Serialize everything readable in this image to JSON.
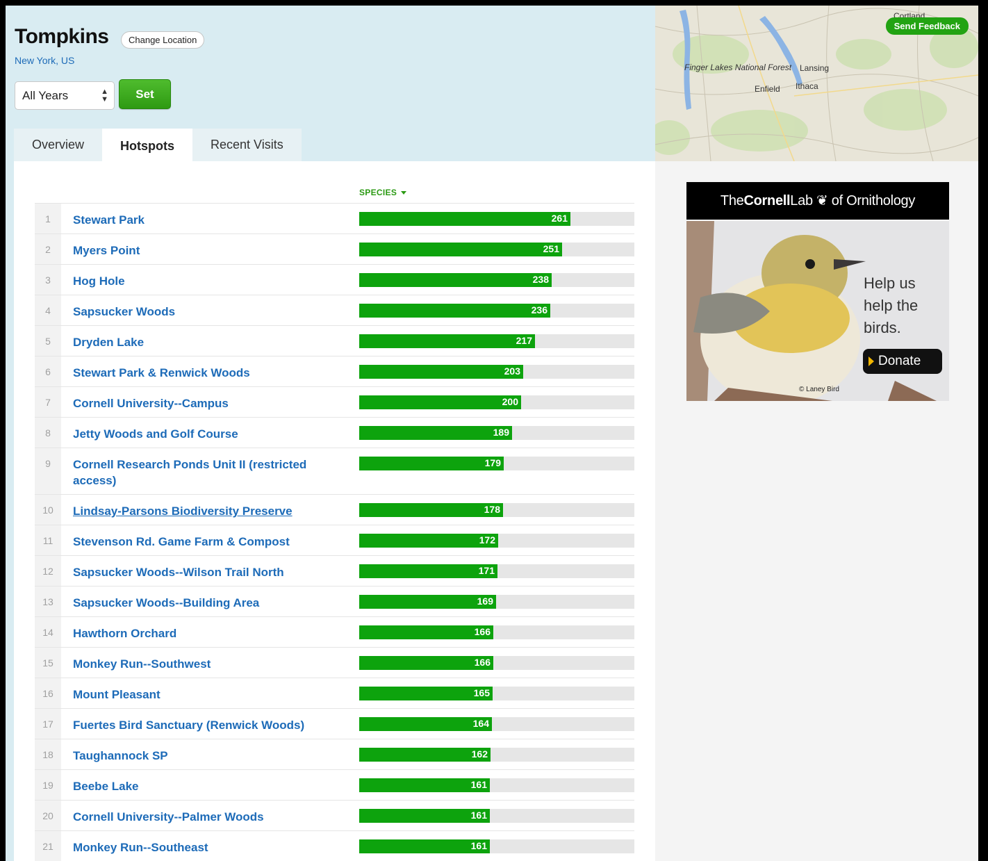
{
  "location": {
    "title": "Tompkins",
    "change_label": "Change Location",
    "region": "New York, US",
    "year_value": "All Years",
    "set_label": "Set"
  },
  "tabs": [
    {
      "label": "Overview",
      "active": false
    },
    {
      "label": "Hotspots",
      "active": true
    },
    {
      "label": "Recent Visits",
      "active": false
    }
  ],
  "table": {
    "column_header": "SPECIES",
    "max_scale": 340,
    "bar_color": "#0da30d",
    "rows": [
      {
        "rank": "1",
        "name": "Stewart Park",
        "species": 261
      },
      {
        "rank": "2",
        "name": "Myers Point",
        "species": 251
      },
      {
        "rank": "3",
        "name": "Hog Hole",
        "species": 238
      },
      {
        "rank": "4",
        "name": "Sapsucker Woods",
        "species": 236
      },
      {
        "rank": "5",
        "name": "Dryden Lake",
        "species": 217
      },
      {
        "rank": "6",
        "name": "Stewart Park & Renwick Woods",
        "species": 203
      },
      {
        "rank": "7",
        "name": "Cornell University--Campus",
        "species": 200
      },
      {
        "rank": "8",
        "name": "Jetty Woods and Golf Course",
        "species": 189
      },
      {
        "rank": "9",
        "name": "Cornell Research Ponds Unit II (restricted access)",
        "species": 179
      },
      {
        "rank": "10",
        "name": "Lindsay-Parsons Biodiversity Preserve",
        "species": 178
      },
      {
        "rank": "11",
        "name": "Stevenson Rd. Game Farm & Compost",
        "species": 172
      },
      {
        "rank": "12",
        "name": "Sapsucker Woods--Wilson Trail North",
        "species": 171
      },
      {
        "rank": "13",
        "name": "Sapsucker Woods--Building Area",
        "species": 169
      },
      {
        "rank": "14",
        "name": "Hawthorn Orchard",
        "species": 166
      },
      {
        "rank": "15",
        "name": "Monkey Run--Southwest",
        "species": 166
      },
      {
        "rank": "16",
        "name": "Mount Pleasant",
        "species": 165
      },
      {
        "rank": "17",
        "name": "Fuertes Bird Sanctuary (Renwick Woods)",
        "species": 164
      },
      {
        "rank": "18",
        "name": "Taughannock SP",
        "species": 162
      },
      {
        "rank": "19",
        "name": "Beebe Lake",
        "species": 161
      },
      {
        "rank": "20",
        "name": "Cornell University--Palmer Woods",
        "species": 161
      },
      {
        "rank": "21",
        "name": "Monkey Run--Southeast",
        "species": 161
      }
    ]
  },
  "map": {
    "feedback_label": "Send Feedback",
    "labels": {
      "forest": "Finger Lakes National Forest",
      "lansing": "Lansing",
      "enfield": "Enfield",
      "ithaca": "Ithaca",
      "cortland": "Cortland"
    }
  },
  "ad": {
    "brand_the": "The",
    "brand_cornell": "Cornell",
    "brand_lab": "Lab",
    "brand_of": "of Ornithology",
    "help_line1": "Help us",
    "help_line2": "help the",
    "help_line3": "birds.",
    "donate_label": "Donate",
    "credit": "© Laney Bird"
  }
}
